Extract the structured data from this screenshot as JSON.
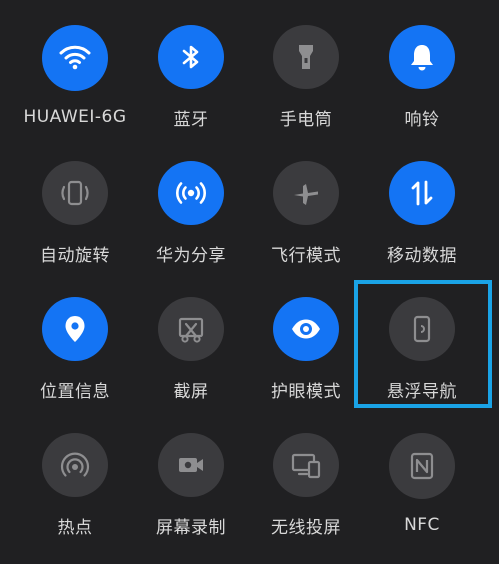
{
  "quick_settings": {
    "tiles": [
      {
        "label": "HUAWEI-6G",
        "icon": "wifi-icon",
        "state": "on"
      },
      {
        "label": "蓝牙",
        "icon": "bluetooth-icon",
        "state": "on"
      },
      {
        "label": "手电筒",
        "icon": "flashlight-icon",
        "state": "off"
      },
      {
        "label": "响铃",
        "icon": "bell-icon",
        "state": "on"
      },
      {
        "label": "自动旋转",
        "icon": "rotate-icon",
        "state": "off"
      },
      {
        "label": "华为分享",
        "icon": "share-icon",
        "state": "on"
      },
      {
        "label": "飞行模式",
        "icon": "airplane-icon",
        "state": "off"
      },
      {
        "label": "移动数据",
        "icon": "mobile-data-icon",
        "state": "on"
      },
      {
        "label": "位置信息",
        "icon": "location-icon",
        "state": "on"
      },
      {
        "label": "截屏",
        "icon": "screenshot-icon",
        "state": "off"
      },
      {
        "label": "护眼模式",
        "icon": "eye-icon",
        "state": "on"
      },
      {
        "label": "悬浮导航",
        "icon": "floating-nav-icon",
        "state": "off"
      },
      {
        "label": "热点",
        "icon": "hotspot-icon",
        "state": "off"
      },
      {
        "label": "屏幕录制",
        "icon": "screen-record-icon",
        "state": "off"
      },
      {
        "label": "无线投屏",
        "icon": "wireless-projection-icon",
        "state": "off"
      },
      {
        "label": "NFC",
        "icon": "nfc-icon",
        "state": "off"
      }
    ]
  },
  "colors": {
    "active": "#1474f4",
    "inactive": "#3b3b3e",
    "highlight": "#1aa3e6"
  }
}
